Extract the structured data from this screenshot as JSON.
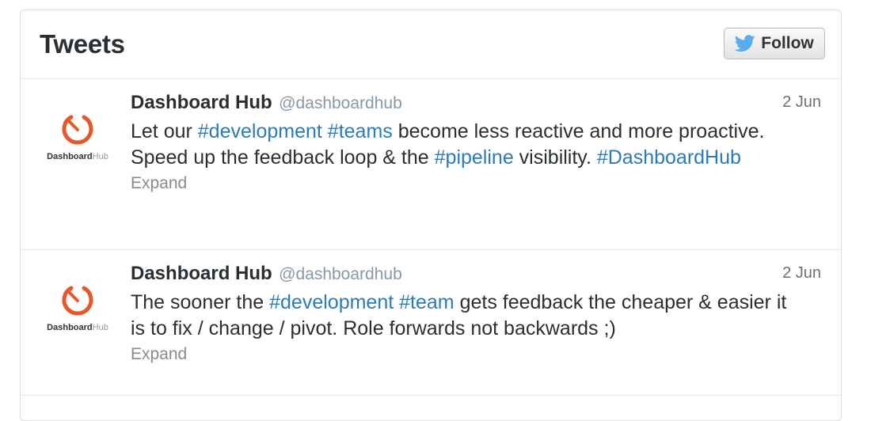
{
  "header": {
    "title": "Tweets",
    "follow_label": "Follow"
  },
  "colors": {
    "hashtag": "#2b7bb9",
    "brand_orange": "#e8572a",
    "twitter_blue": "#55acee"
  },
  "tweets": [
    {
      "author": "Dashboard Hub",
      "handle": "@dashboardhub",
      "date": "2 Jun",
      "avatar_word_bold": "Dashboard",
      "avatar_word_light": "Hub",
      "text": {
        "t1": "Let our ",
        "h1": "#development",
        "t2": " ",
        "h2": "#teams",
        "t3": " become less reactive and more proactive. Speed up the feedback loop & the ",
        "h3": "#pipeline",
        "t4": " visibility. ",
        "h4": "#DashboardHub"
      },
      "expand": "Expand"
    },
    {
      "author": "Dashboard Hub",
      "handle": "@dashboardhub",
      "date": "2 Jun",
      "avatar_word_bold": "Dashboard",
      "avatar_word_light": "Hub",
      "text": {
        "t1": "The sooner the ",
        "h1": "#development",
        "t2": " ",
        "h2": "#team",
        "t3": " gets feedback the cheaper & easier it is to fix / change / pivot. Role forwards not backwards ;)"
      },
      "expand": "Expand"
    }
  ]
}
